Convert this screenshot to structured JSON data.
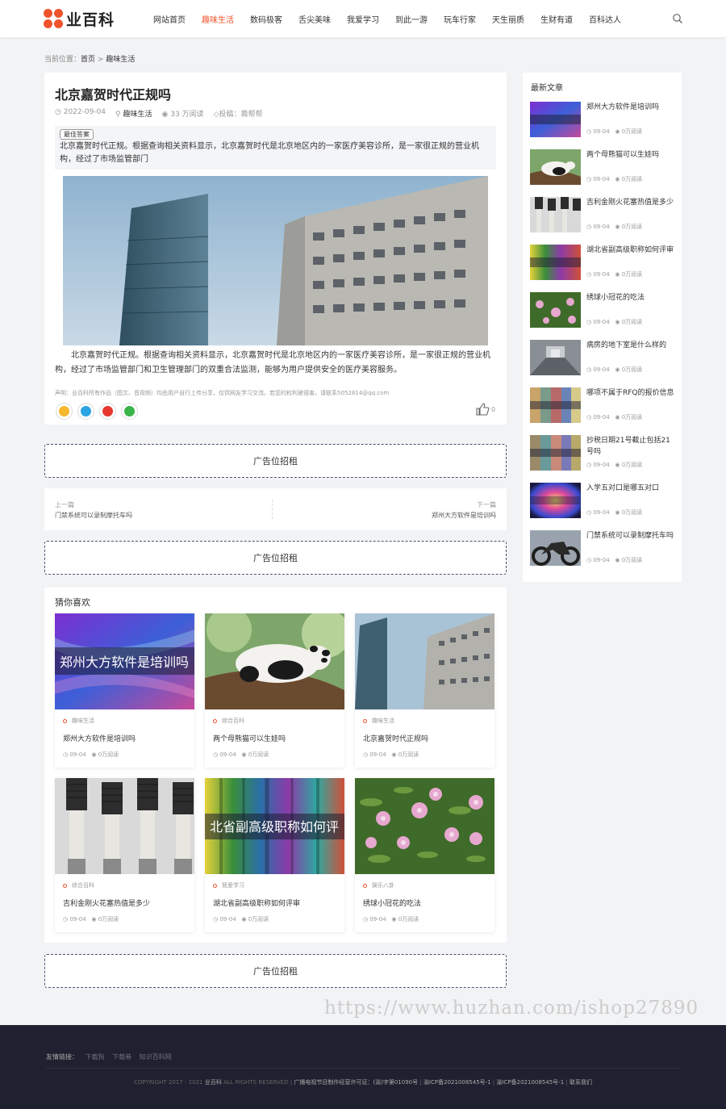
{
  "site": {
    "name": "业百科",
    "brand_color": "#f0532b"
  },
  "nav": [
    {
      "label": "网站首页"
    },
    {
      "label": "趣味生活",
      "active": true
    },
    {
      "label": "数码极客"
    },
    {
      "label": "舌尖美味"
    },
    {
      "label": "我爱学习"
    },
    {
      "label": "到此一游"
    },
    {
      "label": "玩车行家"
    },
    {
      "label": "天生丽质"
    },
    {
      "label": "生财有道"
    },
    {
      "label": "百科达人"
    }
  ],
  "breadcrumb": {
    "prefix": "当前位置：",
    "home": "首页",
    "sep": ">",
    "current": "趣味生活"
  },
  "article": {
    "title": "北京嘉贺时代正规吗",
    "date": "2022-09-04",
    "category": "趣味生活",
    "reads": "33 万阅读",
    "author": "投稿：裔帮帮",
    "summary_tag": "最佳答案",
    "summary": "北京嘉贺时代正规。根据查询相关资料显示，北京嘉贺时代是北京地区内的一家医疗美容诊所，是一家很正规的营业机构，经过了市场监管部门",
    "body": "北京嘉贺时代正规。根据查询相关资料显示，北京嘉贺时代是北京地区内的一家医疗美容诊所，是一家很正规的营业机构，经过了市场监管部门和卫生管理部门的双重合法监测，能够为用户提供安全的医疗美容服务。",
    "declare": "声明：业百科所有作品（图文、音视频）均由用户自行上传分享，仅供网友学习交流。若您的权利被侵害，请联系5052814@qq.com",
    "likes": "0"
  },
  "ads": [
    "广告位招租",
    "广告位招租",
    "广告位招租"
  ],
  "prev_next": {
    "prev_label": "上一篇",
    "prev_title": "门禁系统可以录制摩托车吗",
    "next_label": "下一篇",
    "next_title": "郑州大方软件是培训吗"
  },
  "guess": {
    "title": "猜你喜欢",
    "items": [
      {
        "thumb_text": "郑州大方软件是培训吗",
        "category": "趣味生活",
        "title": "郑州大方软件是培训吗",
        "date": "09-04",
        "reads": "0万阅读"
      },
      {
        "thumb_text": "",
        "category": "综合百科",
        "title": "两个母熊猫可以生娃吗",
        "date": "09-04",
        "reads": "0万阅读"
      },
      {
        "thumb_text": "",
        "category": "趣味生活",
        "title": "北京嘉贺时代正规吗",
        "date": "09-04",
        "reads": "0万阅读"
      },
      {
        "thumb_text": "",
        "category": "综合百科",
        "title": "吉利金刚火花塞热值是多少",
        "date": "09-04",
        "reads": "0万阅读"
      },
      {
        "thumb_text": "北省副高级职称如何评",
        "category": "我爱学习",
        "title": "湖北省副高级职称如何评审",
        "date": "09-04",
        "reads": "0万阅读"
      },
      {
        "thumb_text": "",
        "category": "娱乐八卦",
        "title": "绣球小冠花的吃法",
        "date": "09-04",
        "reads": "0万阅读"
      }
    ]
  },
  "sidebar": {
    "title": "最新文章",
    "items": [
      {
        "title": "郑州大方软件是培训吗",
        "date": "09-04",
        "reads": "0万阅读"
      },
      {
        "title": "两个母熊猫可以生娃吗",
        "date": "09-04",
        "reads": "0万阅读"
      },
      {
        "title": "吉利金刚火花塞热值是多少",
        "date": "09-04",
        "reads": "0万阅读"
      },
      {
        "title": "湖北省副高级职称如何评审",
        "date": "09-04",
        "reads": "0万阅读"
      },
      {
        "title": "绣球小冠花的吃法",
        "date": "09-04",
        "reads": "0万阅读"
      },
      {
        "title": "病房的地下室是什么样的",
        "date": "09-04",
        "reads": "0万阅读"
      },
      {
        "title": "哪项不属于RFQ的报价信息",
        "date": "09-04",
        "reads": "0万阅读"
      },
      {
        "title": "抄税日期21号截止包括21号吗",
        "date": "09-04",
        "reads": "0万阅读"
      },
      {
        "title": "入学五对口是哪五对口",
        "date": "09-04",
        "reads": "0万阅读"
      },
      {
        "title": "门禁系统可以录制摩托车吗",
        "date": "09-04",
        "reads": "0万阅读"
      }
    ]
  },
  "watermark": "https://www.huzhan.com/ishop27890",
  "footer": {
    "links_label": "友情链接：",
    "links": [
      "下载狗",
      "下载巷",
      "知识百科网"
    ],
    "copyright_a": "COPYRIGHT 2017 - 2021",
    "copyright_site": "业百科",
    "copyright_b": "ALL RIGHTS RESERVED",
    "license": "广播电视节目制作经营许可证：(渝)字第01090号",
    "icp1": "渝ICP备2021008545号-1",
    "icp2": "渝ICP备2021008545号-1",
    "contact": "联系我们"
  }
}
